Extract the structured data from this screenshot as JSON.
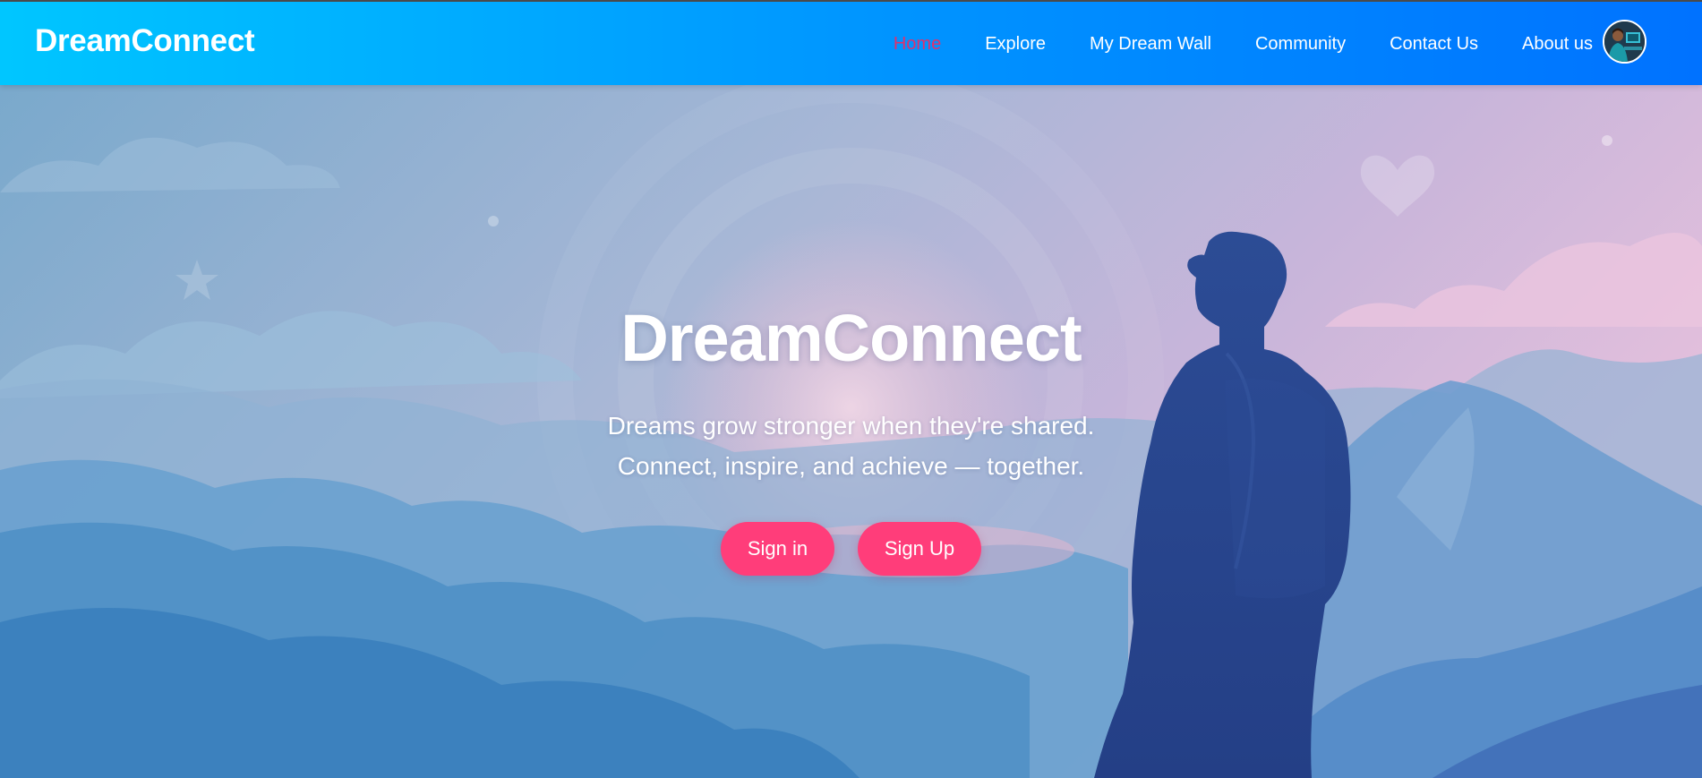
{
  "brand": {
    "name": "DreamConnect"
  },
  "nav": {
    "items": [
      {
        "label": "Home",
        "active": true
      },
      {
        "label": "Explore",
        "active": false
      },
      {
        "label": "My Dream Wall",
        "active": false
      },
      {
        "label": "Community",
        "active": false
      },
      {
        "label": "Contact Us",
        "active": false
      },
      {
        "label": "About us",
        "active": false
      }
    ],
    "active_color": "#e0306d"
  },
  "hero": {
    "title": "DreamConnect",
    "subtitle_line1": "Dreams grow stronger when they're shared.",
    "subtitle_line2": "Connect, inspire, and achieve — together.",
    "signin_label": "Sign in",
    "signup_label": "Sign Up"
  },
  "colors": {
    "navbar_gradient_start": "#00c6ff",
    "navbar_gradient_end": "#0072ff",
    "button": "#ff3d7a"
  }
}
